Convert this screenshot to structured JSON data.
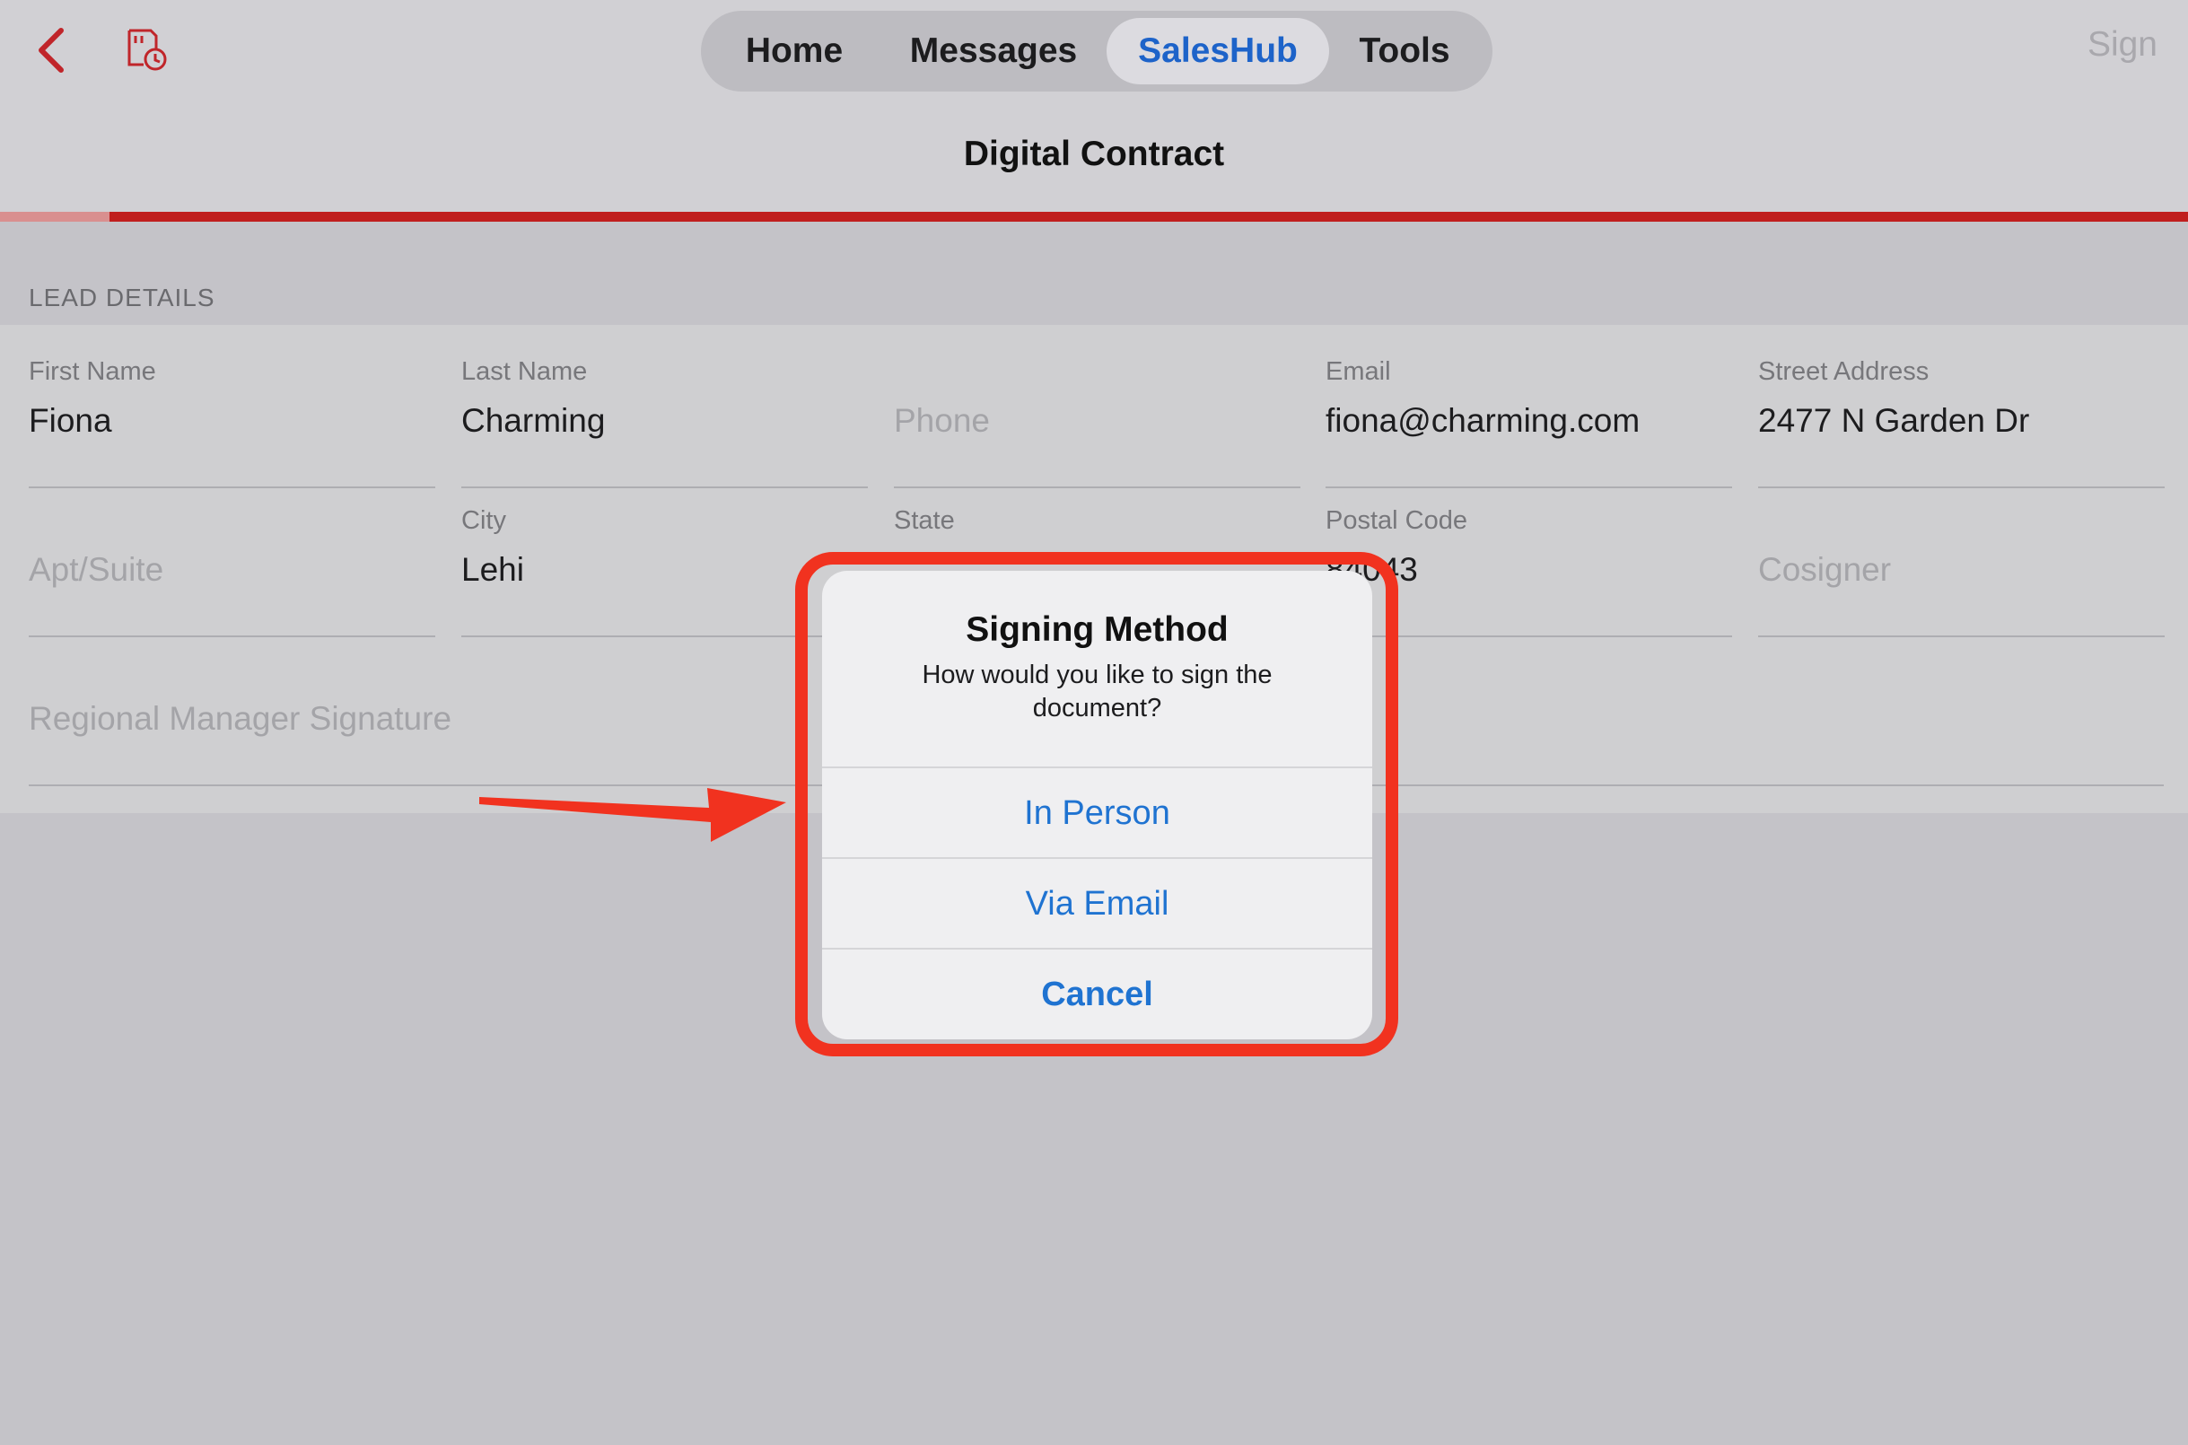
{
  "nav": {
    "tabs": [
      {
        "label": "Home"
      },
      {
        "label": "Messages"
      },
      {
        "label": "SalesHub"
      },
      {
        "label": "Tools"
      }
    ],
    "sign_label": "Sign",
    "title": "Digital Contract",
    "progress_fraction": 0.05
  },
  "section": {
    "header": "LEAD DETAILS"
  },
  "fields": {
    "first_name": {
      "label": "First Name",
      "value": "Fiona"
    },
    "last_name": {
      "label": "Last Name",
      "value": "Charming"
    },
    "phone": {
      "placeholder": "Phone"
    },
    "email": {
      "label": "Email",
      "value": "fiona@charming.com"
    },
    "street": {
      "label": "Street Address",
      "value": "2477 N Garden Dr"
    },
    "apt": {
      "placeholder": "Apt/Suite"
    },
    "city": {
      "label": "City",
      "value": "Lehi"
    },
    "state": {
      "label": "State"
    },
    "postal": {
      "label": "Postal Code",
      "value": "84043"
    },
    "cosigner": {
      "placeholder": "Cosigner"
    },
    "rm_signature": {
      "placeholder": "Regional Manager Signature"
    }
  },
  "dialog": {
    "title": "Signing Method",
    "message": "How would you like to sign the document?",
    "options": {
      "in_person": "In Person",
      "via_email": "Via Email",
      "cancel": "Cancel"
    }
  },
  "colors": {
    "accent_red": "#c01e1e",
    "link_blue": "#1f73d1",
    "annotation_red": "#f1321f"
  },
  "icons": {
    "back": "chevron-left-icon",
    "document_history": "document-clock-icon"
  }
}
